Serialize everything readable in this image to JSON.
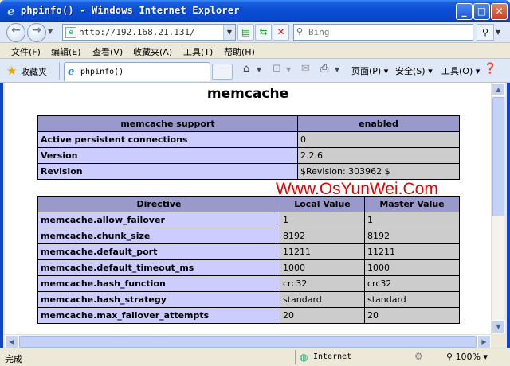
{
  "window": {
    "title": "phpinfo() - Windows Internet Explorer"
  },
  "toolbar": {
    "url": "http://192.168.21.131/",
    "search_placeholder": "Bing"
  },
  "menu": [
    "文件(F)",
    "编辑(E)",
    "查看(V)",
    "收藏夹(A)",
    "工具(T)",
    "帮助(H)"
  ],
  "favorites": {
    "label": "收藏夹"
  },
  "tab": {
    "label": "phpinfo()"
  },
  "commandbar": {
    "page": "页面(P)",
    "safety": "安全(S)",
    "tools": "工具(O)"
  },
  "page": {
    "heading": "memcache",
    "support_table": {
      "headers": [
        "memcache support",
        "enabled"
      ],
      "rows": [
        [
          "Active persistent connections",
          "0"
        ],
        [
          "Version",
          "2.2.6"
        ],
        [
          "Revision",
          "$Revision: 303962 $"
        ]
      ]
    },
    "directive_table": {
      "headers": [
        "Directive",
        "Local Value",
        "Master Value"
      ],
      "rows": [
        [
          "memcache.allow_failover",
          "1",
          "1"
        ],
        [
          "memcache.chunk_size",
          "8192",
          "8192"
        ],
        [
          "memcache.default_port",
          "11211",
          "11211"
        ],
        [
          "memcache.default_timeout_ms",
          "1000",
          "1000"
        ],
        [
          "memcache.hash_function",
          "crc32",
          "crc32"
        ],
        [
          "memcache.hash_strategy",
          "standard",
          "standard"
        ],
        [
          "memcache.max_failover_attempts",
          "20",
          "20"
        ]
      ]
    },
    "watermark": "Www.OsYunWei.Com"
  },
  "status": {
    "text": "完成",
    "zone": "Internet",
    "zoom": "100%"
  },
  "colors": {
    "header_bg": "#9999cc",
    "label_bg": "#ccccff",
    "value_bg": "#cccccc",
    "watermark": "#e60000"
  }
}
